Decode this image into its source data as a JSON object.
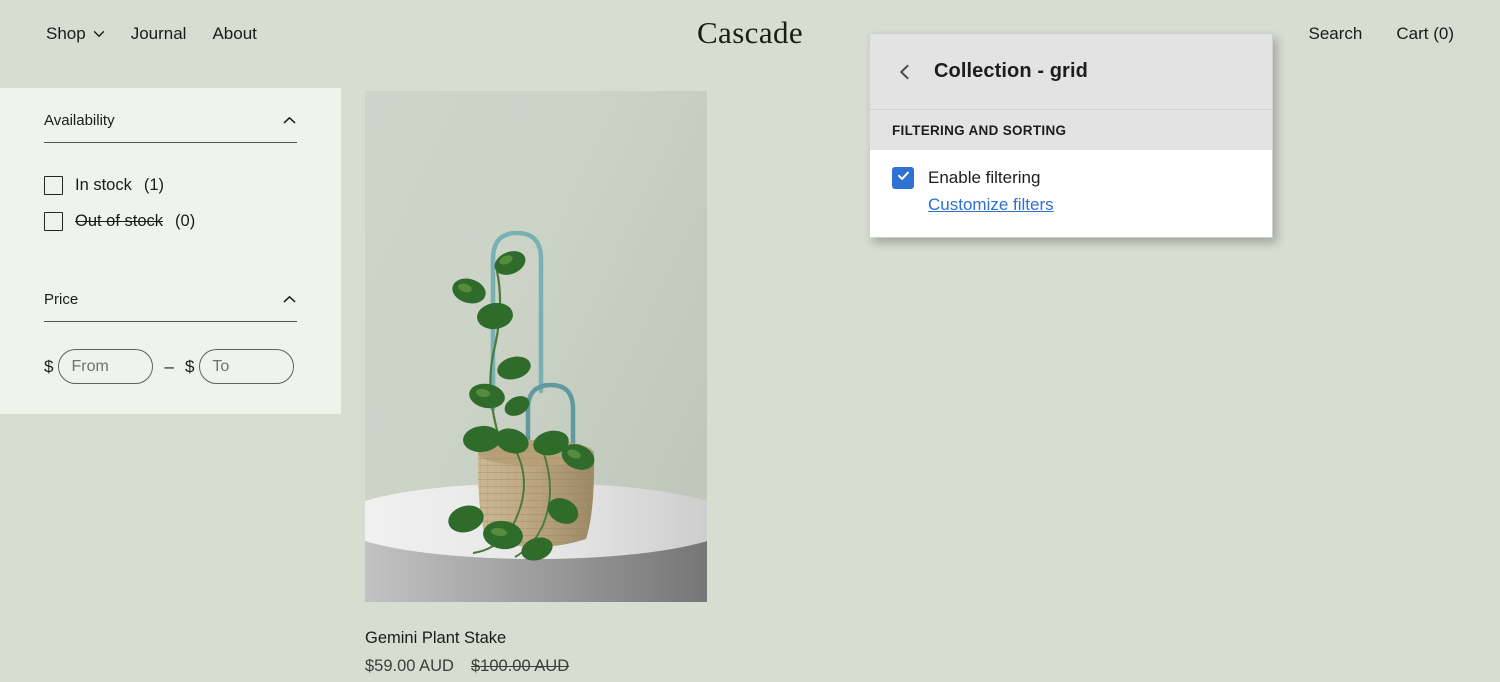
{
  "theme": {
    "page_bg": "#d7ddd1",
    "sidebar_bg": "#eff4ea",
    "accent_blue": "#2f72d4",
    "panel_header_bg": "#e3e3e3"
  },
  "header": {
    "brand": "Cascade",
    "nav": [
      {
        "label": "Shop",
        "has_dropdown": true,
        "icon": "chevron-down-icon"
      },
      {
        "label": "Journal",
        "has_dropdown": false
      },
      {
        "label": "About",
        "has_dropdown": false
      }
    ],
    "search_label": "Search",
    "cart_label": "Cart (0)"
  },
  "filters": {
    "groups": [
      {
        "title": "Availability",
        "toggle_icon": "chevron-up-icon",
        "expanded": true,
        "options": [
          {
            "label": "In stock",
            "count": "(1)",
            "checked": false,
            "disabled": false
          },
          {
            "label": "Out of stock",
            "count": "(0)",
            "checked": false,
            "disabled": true,
            "separator": "-"
          }
        ]
      },
      {
        "title": "Price",
        "toggle_icon": "chevron-up-icon",
        "expanded": true,
        "currency_symbol": "$",
        "range_separator": "–",
        "from": {
          "value": "",
          "placeholder": "From"
        },
        "to": {
          "value": "",
          "placeholder": "To"
        }
      }
    ]
  },
  "products": [
    {
      "title": "Gemini Plant Stake",
      "price": "$59.00 AUD",
      "compare_at_price": "$100.00 AUD",
      "image_alt": "Pothos plant in woven basket with teal arched plant stakes on a white pedestal"
    }
  ],
  "editor_panel": {
    "back_icon": "chevron-left-icon",
    "title": "Collection - grid",
    "section_title": "FILTERING AND SORTING",
    "enable_filtering": {
      "label": "Enable filtering",
      "checked": true,
      "icon": "checkmark-icon"
    },
    "customize_link": "Customize filters"
  }
}
